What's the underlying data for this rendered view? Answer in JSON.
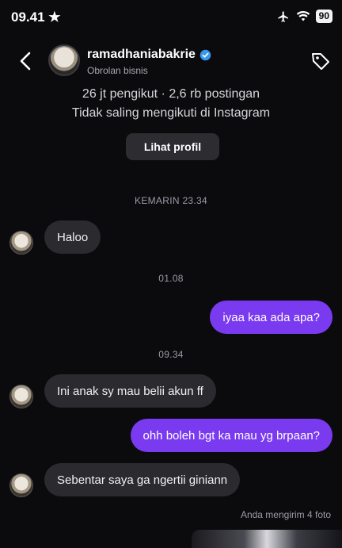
{
  "status_bar": {
    "time": "09.41",
    "battery": "90"
  },
  "header": {
    "username": "ramadhaniabakrie",
    "subtitle": "Obrolan bisnis"
  },
  "profile": {
    "stats": "26 jt pengikut · 2,6 rb postingan",
    "follow_status": "Tidak saling mengikuti di Instagram",
    "view_profile_label": "Lihat profil"
  },
  "messages": [
    {
      "type": "timestamp",
      "text": "KEMARIN 23.34"
    },
    {
      "type": "incoming",
      "text": "Haloo"
    },
    {
      "type": "timestamp",
      "text": "01.08"
    },
    {
      "type": "outgoing",
      "text": "iyaa kaa ada apa?"
    },
    {
      "type": "timestamp",
      "text": "09.34"
    },
    {
      "type": "incoming",
      "text": "Ini anak sy mau belii akun ff"
    },
    {
      "type": "outgoing",
      "text": "ohh boleh bgt ka mau yg brpaan?"
    },
    {
      "type": "incoming",
      "text": "Sebentar saya ga ngertii giniann"
    }
  ],
  "sent_note": "Anda mengirim 4 foto",
  "colors": {
    "background": "#0b0b0e",
    "incoming_bubble": "#2a2a2f",
    "outgoing_bubble": "#7a3af0",
    "verified": "#3897f0"
  }
}
